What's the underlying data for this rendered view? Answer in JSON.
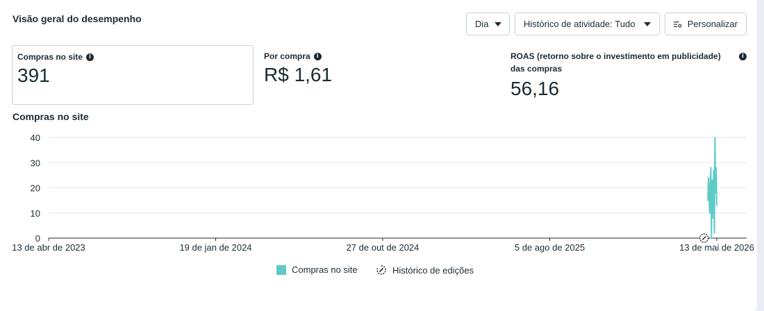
{
  "header": {
    "title": "Visão geral do desempenho",
    "day_label": "Dia",
    "activity_label": "Histórico de atividade: Tudo",
    "customize_label": "Personalizar"
  },
  "metrics": [
    {
      "label": "Compras no site",
      "value": "391"
    },
    {
      "label": "Por compra",
      "value": "R$ 1,61"
    },
    {
      "label_line1": "ROAS (retorno sobre o investimento em publicidade)",
      "label_line2": "das compras",
      "value": "56,16"
    }
  ],
  "chart_title": "Compras no site",
  "legend": {
    "series_label": "Compras no site",
    "edits_label": "Histórico de edições"
  },
  "colors": {
    "series": "#5ecbc8",
    "grid": "#e4e6eb",
    "text": "#1c2b33"
  },
  "chart_data": {
    "type": "line",
    "title": "Compras no site",
    "y_ticks": [
      0,
      10,
      20,
      30,
      40
    ],
    "ylim": [
      0,
      40
    ],
    "x_ticks": [
      "13 de abr de 2023",
      "19 de jan de 2024",
      "27 de out de 2024",
      "5 de ago de 2025",
      "13 de mai de 2026"
    ],
    "x_range": [
      "2023-04-13",
      "2026-05-13"
    ],
    "series": [
      {
        "name": "Compras no site",
        "x": [
          "2026-04-28",
          "2026-04-29",
          "2026-04-30",
          "2026-05-01",
          "2026-05-02",
          "2026-05-03",
          "2026-05-04",
          "2026-05-05",
          "2026-05-06",
          "2026-05-07",
          "2026-05-08",
          "2026-05-09",
          "2026-05-10",
          "2026-05-11",
          "2026-05-12",
          "2026-05-13"
        ],
        "values": [
          15,
          24,
          17,
          10,
          22,
          28,
          0,
          23,
          8,
          20,
          27,
          2,
          40,
          18,
          28,
          13
        ]
      }
    ],
    "edit_markers": [
      "2026-05-08"
    ],
    "grid": true,
    "legend_position": "bottom-center"
  }
}
